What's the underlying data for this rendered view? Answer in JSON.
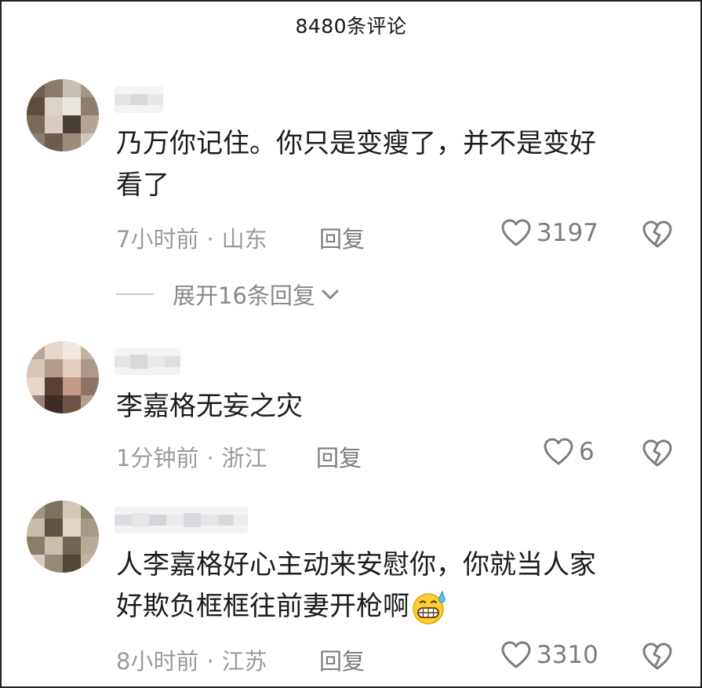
{
  "header": {
    "title": "8480条评论"
  },
  "comments": [
    {
      "text_lines": [
        "乃万你记住。你只是变瘦了，并不是变好",
        "看了"
      ],
      "time": "7小时前",
      "location": "山东",
      "reply_label": "回复",
      "likes": "3197",
      "expand_label": "展开16条回复"
    },
    {
      "text_lines": [
        "李嘉格无妄之灾"
      ],
      "time": "1分钟前",
      "location": "浙江",
      "reply_label": "回复",
      "likes": "6"
    },
    {
      "text_lines": [
        "人李嘉格好心主动来安慰你，你就当人家",
        "好欺负框框往前妻开枪啊"
      ],
      "time": "8小时前",
      "location": "江苏",
      "reply_label": "回复",
      "likes": "3310"
    }
  ],
  "icons": {
    "like": "heart-outline-icon",
    "dislike": "broken-heart-icon",
    "expand": "chevron-down-icon",
    "emoji": "grimacing-sweat-emoji"
  },
  "colors": {
    "text": "#1c1c1c",
    "meta": "#9b9b9b",
    "reply": "#7c7c7c",
    "icon": "#7d7d7d"
  }
}
